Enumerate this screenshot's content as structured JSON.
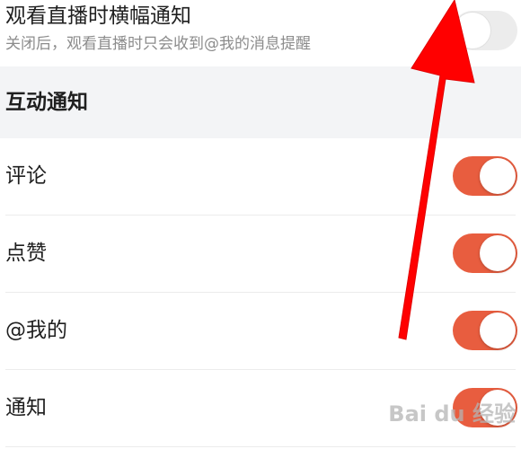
{
  "landscape_live_notice": {
    "title": "观看直播时横幅通知",
    "description": "关闭后，观看直播时只会收到@我的消息提醒",
    "enabled": false
  },
  "interaction_section": {
    "title": "互动通知",
    "items": [
      {
        "label": "评论",
        "enabled": true
      },
      {
        "label": "点赞",
        "enabled": true
      },
      {
        "label": "@我的",
        "enabled": true
      },
      {
        "label": "通知",
        "enabled": true
      }
    ]
  },
  "colors": {
    "toggle_on": "#e85d3f",
    "toggle_off": "#ececec",
    "arrow": "#ff0000"
  },
  "watermark": {
    "text": "Bai du 经验"
  }
}
